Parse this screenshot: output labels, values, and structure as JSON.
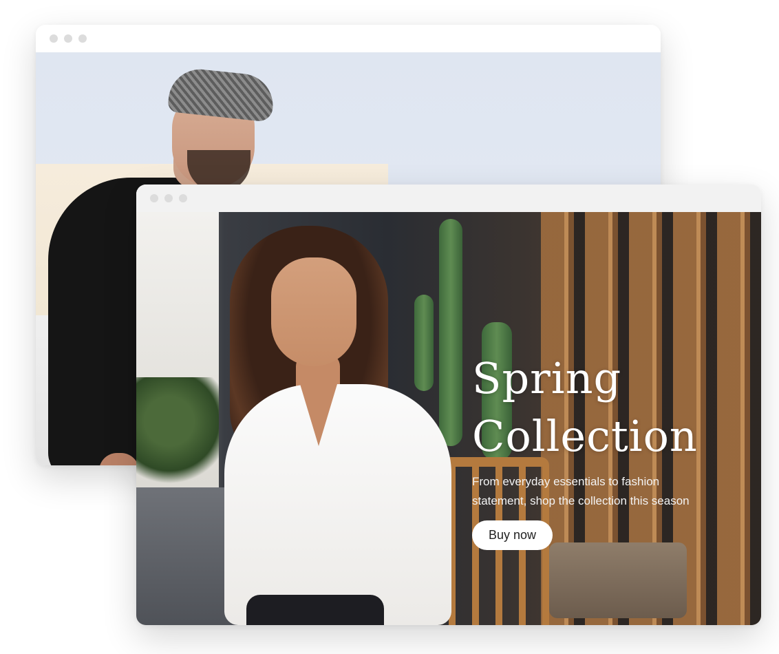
{
  "back_window": {
    "title_dots": [
      "close",
      "minimize",
      "maximize"
    ],
    "image": "man-in-flat-cap-photo"
  },
  "front_window": {
    "title_dots": [
      "close",
      "minimize",
      "maximize"
    ],
    "image": "woman-in-white-shirt-photo",
    "hero": {
      "title_line1": "Spring",
      "title_line2": "Collection",
      "subtitle_line1": "From everyday essentials to fashion",
      "subtitle_line2": "statement, shop the collection this season",
      "cta_label": "Buy now"
    }
  },
  "colors": {
    "titlebar_dot": "#dcdcdc",
    "cta_background": "#ffffff",
    "hero_text": "#ffffff"
  }
}
